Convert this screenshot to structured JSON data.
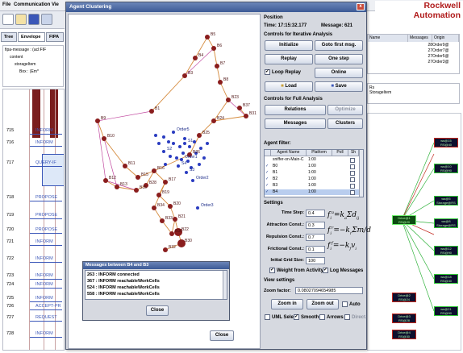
{
  "menubar": {
    "items": [
      "File",
      "Communication",
      "Vie"
    ]
  },
  "brand": "Rockwell Automation",
  "tabs": [
    "Tree",
    "Envelope",
    "FIPA"
  ],
  "tree": {
    "items": [
      "fipa-message : (acl:FIF",
      "content",
      "storageItem",
      "Box : (Em*"
    ]
  },
  "sequence": {
    "rows": [
      {
        "num": "715",
        "text": "INFORM"
      },
      {
        "num": "716",
        "text": "INFORM"
      },
      {
        "num": "717",
        "text": "QUERY-IF"
      },
      {
        "num": "718",
        "text": "PROPOSE"
      },
      {
        "num": "719",
        "text": "PROPOSE"
      },
      {
        "num": "720",
        "text": "PROPOSE"
      },
      {
        "num": "721",
        "text": "INFORM"
      },
      {
        "num": "722",
        "text": "INFORM"
      },
      {
        "num": "723",
        "text": "INFORM"
      },
      {
        "num": "724",
        "text": "INFORM"
      },
      {
        "num": "725",
        "text": "INFORM"
      },
      {
        "num": "726",
        "text": "ACCEPT-PR"
      },
      {
        "num": "727",
        "text": "REQUEST"
      },
      {
        "num": "728",
        "text": "INFORM"
      }
    ]
  },
  "bg_table": {
    "headers": [
      "Name",
      "Messages",
      "Origin"
    ],
    "rows": [
      [
        "",
        "28",
        "Order9@"
      ],
      [
        "",
        "27",
        "Order7@"
      ],
      [
        "",
        "27",
        "Order5@"
      ],
      [
        "",
        "27",
        "Order3@"
      ]
    ]
  },
  "bg_info": [
    "Rs",
    "StorageItem"
  ],
  "graph_nodes": {
    "center": [
      "Drive@1",
      "RS@20"
    ],
    "right": [
      [
        "ws@15",
        "RS@40"
      ],
      [
        "ws@10",
        "RS@90"
      ],
      [
        "ws@5",
        "Storage@RS"
      ],
      [
        "ws@8",
        "Storage@RS"
      ],
      [
        "ws@12",
        "RS@90"
      ],
      [
        "ws@18",
        "RS@40"
      ],
      [
        "ws@21",
        "RS@90"
      ]
    ],
    "bottom_left": [
      [
        "Drive@2",
        "RS@24"
      ],
      [
        "Drive@3",
        "RS@28"
      ],
      [
        "Drive@4",
        "RS@30"
      ]
    ]
  },
  "dialog": {
    "title": "Agent Clustering",
    "close_label": "Close",
    "close_x": "x"
  },
  "graph_labels": [
    "B1",
    "B3",
    "B4",
    "B5",
    "B6",
    "B7",
    "B8",
    "B9",
    "B10",
    "B11",
    "B12",
    "B13",
    "B15",
    "B16",
    "B17",
    "B19",
    "B20",
    "B21",
    "B22",
    "B23",
    "B24",
    "B25",
    "B26",
    "B28",
    "B30",
    "B31",
    "B32",
    "B33",
    "B34",
    "B35",
    "B36",
    "B37",
    "Order1",
    "Order2",
    "Order3",
    "Order5",
    "S1",
    "S2",
    "S3",
    "S4"
  ],
  "position": {
    "heading": "Position",
    "time_label": "Time:",
    "time_value": "17:15:32.177",
    "message_label": "Message:",
    "message_value": "621"
  },
  "iterative": {
    "heading": "Controls for Iterative Analysis",
    "buttons": [
      "Initialize",
      "Goto first msg.",
      "Replay",
      "One step"
    ],
    "loop_replay": "Loop Replay",
    "online": "Online",
    "load": "Load",
    "save": "Save"
  },
  "full": {
    "heading": "Controls for Full Analysis",
    "relations": "Relations",
    "optimize": "Optimize",
    "messages": "Messages",
    "clusters": "Clusters"
  },
  "agent_filter": {
    "heading": "Agent filter:",
    "columns": [
      "",
      "Agent Name",
      "Platform",
      "Poll",
      "Sh"
    ],
    "rows": [
      {
        "name": "sniffer-on-Main-C",
        "platform": "1:00"
      },
      {
        "name": "B0",
        "platform": "1:00"
      },
      {
        "name": "B1",
        "platform": "1:00"
      },
      {
        "name": "B2",
        "platform": "1:00"
      },
      {
        "name": "B3",
        "platform": "1:00"
      },
      {
        "name": "B4",
        "platform": "1:00"
      }
    ]
  },
  "settings": {
    "heading": "Settings",
    "fields": [
      {
        "label": "Time Step:",
        "value": "0.4"
      },
      {
        "label": "Attraction Const.:",
        "value": "0.3"
      },
      {
        "label": "Repulsion Const.:",
        "value": "0.7"
      },
      {
        "label": "Frictional Const.:",
        "value": "0.1"
      },
      {
        "label": "Initial Grid Size:",
        "value": "100"
      }
    ],
    "weight_label": "Weight from Activity",
    "log_label": "Log Messages"
  },
  "view": {
    "heading": "View settings",
    "zoom_label": "Zoom factor:",
    "zoom_value": "0.08027094654985",
    "zoom_in": "Zoom in",
    "zoom_out": "Zoom out",
    "auto": "Auto",
    "uml_select": "UML Select",
    "smooth": "Smooth",
    "arrows": "Arrows",
    "direct": "Direct."
  },
  "messages_dialog": {
    "title": "Messages between B4 and B3",
    "items": [
      "263 : INFORM connected",
      "367 : INFORM reachableWorkCells",
      "524 : INFORM reachableWorkCells",
      "558 : INFORM reachableWorkCells"
    ],
    "close_label": "Close"
  },
  "colors": {
    "title_bar": "#3c5a96",
    "edge_orange": "#d58a3c",
    "edge_magenta": "#c24aa0",
    "node_maroon": "#8a1d1d",
    "node_blue": "#2a3cc0",
    "brand_red": "#b01a1a"
  }
}
